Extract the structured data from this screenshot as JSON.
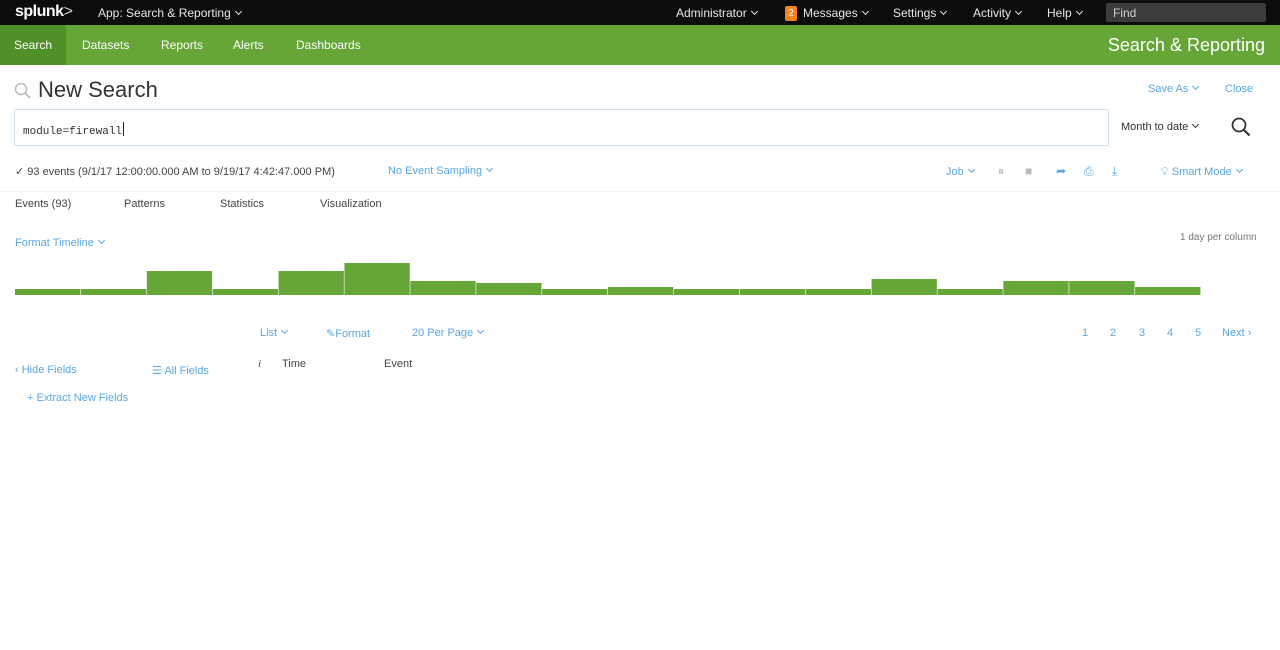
{
  "topbar": {
    "logo": "splunk",
    "logo_suffix": ">",
    "app_label": "App: Search & Reporting",
    "administrator": "Administrator",
    "messages_count": "2",
    "messages": "Messages",
    "settings": "Settings",
    "activity": "Activity",
    "help": "Help",
    "find_placeholder": "Find"
  },
  "appbar": {
    "nav": [
      "Search",
      "Datasets",
      "Reports",
      "Alerts",
      "Dashboards"
    ],
    "active_index": 0,
    "title": "Search & Reporting"
  },
  "search": {
    "title": "New Search",
    "save_as": "Save As",
    "close": "Close",
    "query": "module=firewall",
    "time_range": "Month to date"
  },
  "status": {
    "summary": "93 events (9/1/17 12:00:00.000 AM to 9/19/17 4:42:47.000 PM)",
    "sampling": "No Event Sampling",
    "job": "Job",
    "mode": "Smart Mode"
  },
  "tabs": [
    "Events (93)",
    "Patterns",
    "Statistics",
    "Visualization"
  ],
  "timeline": {
    "format_label": "Format Timeline",
    "scale_label": "1 day per column",
    "bar_levels": [
      0.15,
      0.15,
      0.6,
      0.15,
      0.6,
      0.8,
      0.35,
      0.3,
      0.15,
      0.2,
      0.15,
      0.15,
      0.15,
      0.4,
      0.15,
      0.35,
      0.35,
      0.2
    ],
    "color": "#65a637"
  },
  "results": {
    "list": "List",
    "format": "Format",
    "per_page": "20 Per Page",
    "pages": [
      "1",
      "2",
      "3",
      "4",
      "5"
    ],
    "next": "Next",
    "hide_fields": "Hide Fields",
    "all_fields": "All Fields",
    "extract_fields": "+ Extract New Fields",
    "col_i": "i",
    "col_time": "Time",
    "col_event": "Event"
  }
}
